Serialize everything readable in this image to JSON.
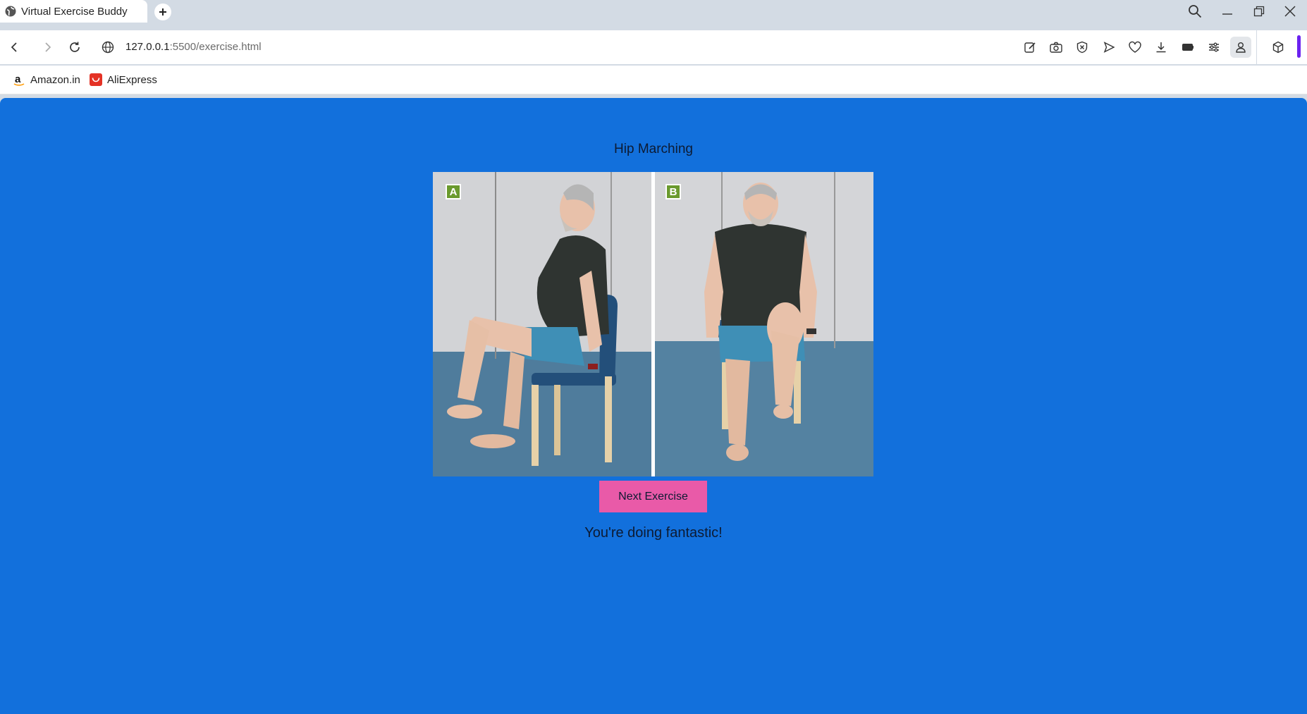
{
  "browser": {
    "tab_title": "Virtual Exercise Buddy",
    "url_host": "127.0.0.1",
    "url_rest": ":5500/exercise.html",
    "bookmarks": [
      {
        "label": "Amazon.in",
        "icon": "amazon-icon"
      },
      {
        "label": "AliExpress",
        "icon": "aliexpress-icon"
      }
    ]
  },
  "page": {
    "exercise_title": "Hip Marching",
    "image_panels": [
      "A",
      "B"
    ],
    "next_button": "Next Exercise",
    "encouragement": "You're doing fantastic!"
  },
  "colors": {
    "page_background": "#1270dc",
    "button": "#e95aa8",
    "panel_label": "#6a9a2e"
  }
}
